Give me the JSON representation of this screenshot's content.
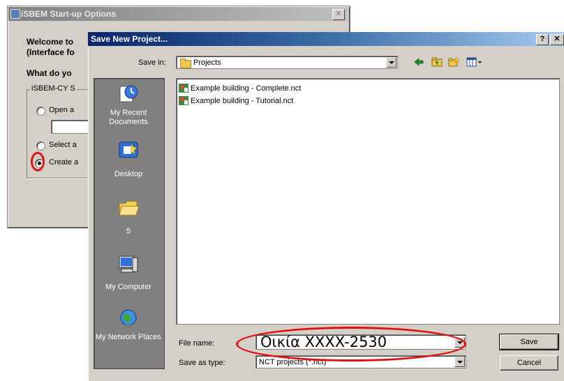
{
  "background_window": {
    "title": "iSBEM Start-up Options",
    "close_glyph": "✕",
    "welcome_line1": "Welcome to",
    "welcome_line2": "(Interface fo",
    "question": "What do yo",
    "group_label": "iSBEM-CY S",
    "option_open": "Open a",
    "option_select": "Select a",
    "option_create": "Create a",
    "selected_option": "create"
  },
  "dialog": {
    "title": "Save New Project...",
    "help_glyph": "?",
    "close_glyph": "✕",
    "save_in_label": "Save in:",
    "save_in_value": "Projects",
    "toolbar_icons": [
      "back-arrow-icon",
      "up-folder-icon",
      "new-folder-icon",
      "views-menu-icon"
    ],
    "places": [
      {
        "label": "My Recent Documents",
        "icon": "recent-documents-icon"
      },
      {
        "label": "Desktop",
        "icon": "desktop-icon"
      },
      {
        "label": "5",
        "icon": "folder-icon"
      },
      {
        "label": "My Computer",
        "icon": "computer-icon"
      },
      {
        "label": "My Network Places",
        "icon": "network-places-icon"
      }
    ],
    "files": [
      {
        "name": "Example building - Complete.nct",
        "icon": "nct-file-icon"
      },
      {
        "name": "Example building - Tutorial.nct",
        "icon": "nct-file-icon"
      }
    ],
    "file_name_label": "File name:",
    "file_name_value": "Οικία XXXX-2530",
    "save_as_type_label": "Save as type:",
    "save_as_type_value": "NCT projects (*.nct)",
    "save_button": "Save",
    "cancel_button": "Cancel"
  },
  "colors": {
    "highlight_circle": "#e01010",
    "titlebar_active": "#0a246a",
    "places_bar": "#808080",
    "dialog_face": "#d4d0c8"
  }
}
